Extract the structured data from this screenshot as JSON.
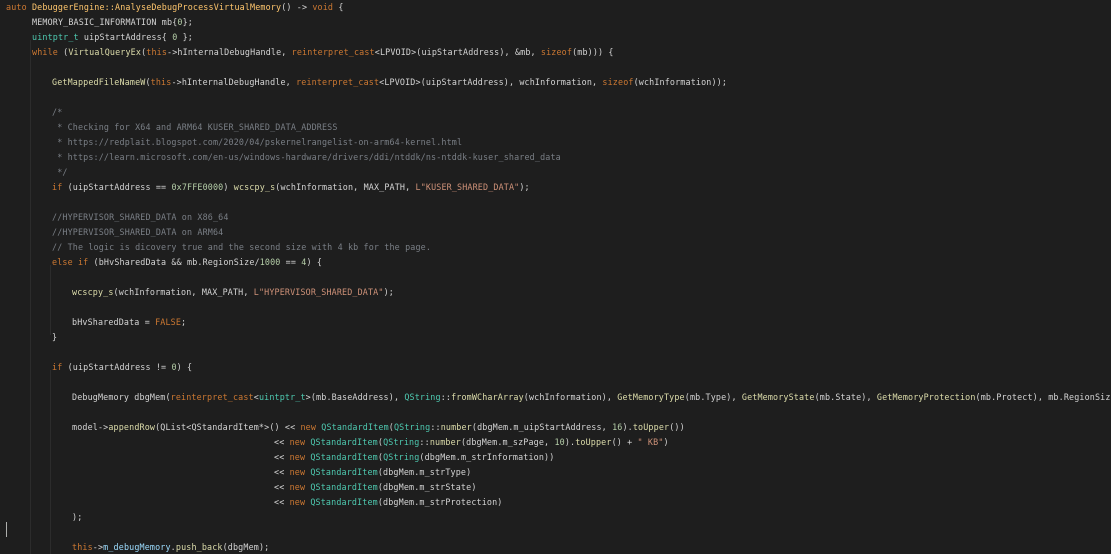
{
  "editor": {
    "language": "C++",
    "theme": {
      "background": "#1e1e1e",
      "keyword": "#cc7832",
      "type": "#4ec9b0",
      "function": "#dcdcaa",
      "number": "#b5cea8",
      "string": "#ce9178",
      "comment": "#7a7f86",
      "default": "#d4d4d4"
    },
    "lines": [
      {
        "indent": 0,
        "tokens": [
          [
            "k",
            "auto "
          ],
          [
            "fc",
            "DebuggerEngine::AnalyseDebugProcessVirtualMemory"
          ],
          [
            "p",
            "() -> "
          ],
          [
            "k",
            "void"
          ],
          [
            "p",
            " {"
          ]
        ]
      },
      {
        "indent": 26,
        "tokens": [
          [
            "p",
            "MEMORY_BASIC_INFORMATION mb{"
          ],
          [
            "n",
            "0"
          ],
          [
            "p",
            "};"
          ]
        ]
      },
      {
        "indent": 26,
        "tokens": [
          [
            "t",
            "uintptr_t"
          ],
          [
            "p",
            " uipStartAddress{ "
          ],
          [
            "n",
            "0"
          ],
          [
            "p",
            " };"
          ]
        ]
      },
      {
        "indent": 26,
        "tokens": [
          [
            "k",
            "while"
          ],
          [
            "p",
            " ("
          ],
          [
            "f",
            "VirtualQueryEx"
          ],
          [
            "p",
            "("
          ],
          [
            "k",
            "this"
          ],
          [
            "p",
            "->hInternalDebugHandle, "
          ],
          [
            "k",
            "reinterpret_cast"
          ],
          [
            "p",
            "<LPVOID>(uipStartAddress), &mb, "
          ],
          [
            "k",
            "sizeof"
          ],
          [
            "p",
            "(mb))) {"
          ]
        ]
      },
      {
        "indent": 46,
        "tokens": [
          [
            "f",
            "GetMappedFileNameW"
          ],
          [
            "p",
            "("
          ],
          [
            "k",
            "this"
          ],
          [
            "p",
            "->hInternalDebugHandle, "
          ],
          [
            "k",
            "reinterpret_cast"
          ],
          [
            "p",
            "<LPVOID>(uipStartAddress), wchInformation, "
          ],
          [
            "k",
            "sizeof"
          ],
          [
            "p",
            "(wchInformation));"
          ]
        ]
      },
      {
        "indent": 46,
        "tokens": [
          [
            "c",
            "/*"
          ]
        ]
      },
      {
        "indent": 46,
        "tokens": [
          [
            "c",
            " * Checking for X64 and ARM64 KUSER_SHARED_DATA_ADDRESS"
          ]
        ]
      },
      {
        "indent": 46,
        "tokens": [
          [
            "c",
            " * https://redplait.blogspot.com/2020/04/pskernelrangelist-on-arm64-kernel.html"
          ]
        ]
      },
      {
        "indent": 46,
        "tokens": [
          [
            "c",
            " * https://learn.microsoft.com/en-us/windows-hardware/drivers/ddi/ntddk/ns-ntddk-kuser_shared_data"
          ]
        ]
      },
      {
        "indent": 46,
        "tokens": [
          [
            "c",
            " */"
          ]
        ]
      },
      {
        "indent": 46,
        "tokens": [
          [
            "k",
            "if"
          ],
          [
            "p",
            " (uipStartAddress == "
          ],
          [
            "n",
            "0x7FFE0000"
          ],
          [
            "p",
            ") "
          ],
          [
            "f",
            "wcscpy_s"
          ],
          [
            "p",
            "(wchInformation, MAX_PATH, "
          ],
          [
            "s",
            "L\"KUSER_SHARED_DATA\""
          ],
          [
            "p",
            ");"
          ]
        ]
      },
      {
        "indent": 46,
        "tokens": [
          [
            "c",
            "//HYPERVISOR_SHARED_DATA on X86_64"
          ]
        ]
      },
      {
        "indent": 46,
        "tokens": [
          [
            "c",
            "//HYPERVISOR_SHARED_DATA on ARM64"
          ]
        ]
      },
      {
        "indent": 46,
        "tokens": [
          [
            "c",
            "// The logic is dicovery true and the second size with 4 kb for the page."
          ]
        ]
      },
      {
        "indent": 46,
        "tokens": [
          [
            "k",
            "else if"
          ],
          [
            "p",
            " (bHvSharedData && mb.RegionSize/"
          ],
          [
            "n",
            "1000"
          ],
          [
            "p",
            " == "
          ],
          [
            "n",
            "4"
          ],
          [
            "p",
            ") {"
          ]
        ]
      },
      {
        "indent": 66,
        "tokens": [
          [
            "f",
            "wcscpy_s"
          ],
          [
            "p",
            "(wchInformation, MAX_PATH, "
          ],
          [
            "s",
            "L\"HYPERVISOR_SHARED_DATA\""
          ],
          [
            "p",
            ");"
          ]
        ]
      },
      {
        "indent": 66,
        "tokens": [
          [
            "p",
            "bHvSharedData = "
          ],
          [
            "k",
            "FALSE"
          ],
          [
            "p",
            ";"
          ]
        ]
      },
      {
        "indent": 46,
        "tokens": [
          [
            "p",
            "}"
          ]
        ]
      },
      {
        "indent": 46,
        "tokens": [
          [
            "k",
            "if"
          ],
          [
            "p",
            " (uipStartAddress != "
          ],
          [
            "n",
            "0"
          ],
          [
            "p",
            ") {"
          ]
        ]
      },
      {
        "indent": 66,
        "tokens": [
          [
            "p",
            "DebugMemory dbgMem("
          ],
          [
            "k",
            "reinterpret_cast"
          ],
          [
            "p",
            "<"
          ],
          [
            "t",
            "uintptr_t"
          ],
          [
            "p",
            ">(mb.BaseAddress), "
          ],
          [
            "t",
            "QString"
          ],
          [
            "p",
            "::"
          ],
          [
            "f",
            "fromWCharArray"
          ],
          [
            "p",
            "(wchInformation), "
          ],
          [
            "f",
            "GetMemoryType"
          ],
          [
            "p",
            "(mb.Type), "
          ],
          [
            "f",
            "GetMemoryState"
          ],
          [
            "p",
            "(mb.State), "
          ],
          [
            "f",
            "GetMemoryProtection"
          ],
          [
            "p",
            "(mb.Protect), mb.RegionSize/"
          ],
          [
            "n",
            "1000"
          ],
          [
            "p",
            ");"
          ]
        ]
      },
      {
        "indent": 66,
        "tokens": [
          [
            "p",
            "model->"
          ],
          [
            "f",
            "appendRow"
          ],
          [
            "p",
            "(QList<QStandardItem*>() << "
          ],
          [
            "k",
            "new"
          ],
          [
            "p",
            " "
          ],
          [
            "t",
            "QStandardItem"
          ],
          [
            "p",
            "("
          ],
          [
            "t",
            "QString"
          ],
          [
            "p",
            "::"
          ],
          [
            "f",
            "number"
          ],
          [
            "p",
            "(dbgMem.m_uipStartAddress, "
          ],
          [
            "n",
            "16"
          ],
          [
            "p",
            ")."
          ],
          [
            "f",
            "toUpper"
          ],
          [
            "p",
            "())"
          ]
        ]
      },
      {
        "indent": 268,
        "tokens": [
          [
            "p",
            "<< "
          ],
          [
            "k",
            "new"
          ],
          [
            "p",
            " "
          ],
          [
            "t",
            "QStandardItem"
          ],
          [
            "p",
            "("
          ],
          [
            "t",
            "QString"
          ],
          [
            "p",
            "::"
          ],
          [
            "f",
            "number"
          ],
          [
            "p",
            "(dbgMem.m_szPage, "
          ],
          [
            "n",
            "10"
          ],
          [
            "p",
            ")."
          ],
          [
            "f",
            "toUpper"
          ],
          [
            "p",
            "() + "
          ],
          [
            "s",
            "\" KB\""
          ],
          [
            "p",
            ")"
          ]
        ]
      },
      {
        "indent": 268,
        "tokens": [
          [
            "p",
            "<< "
          ],
          [
            "k",
            "new"
          ],
          [
            "p",
            " "
          ],
          [
            "t",
            "QStandardItem"
          ],
          [
            "p",
            "("
          ],
          [
            "t",
            "QString"
          ],
          [
            "p",
            "(dbgMem.m_strInformation))"
          ]
        ]
      },
      {
        "indent": 268,
        "tokens": [
          [
            "p",
            "<< "
          ],
          [
            "k",
            "new"
          ],
          [
            "p",
            " "
          ],
          [
            "t",
            "QStandardItem"
          ],
          [
            "p",
            "(dbgMem.m_strType)"
          ]
        ]
      },
      {
        "indent": 268,
        "tokens": [
          [
            "p",
            "<< "
          ],
          [
            "k",
            "new"
          ],
          [
            "p",
            " "
          ],
          [
            "t",
            "QStandardItem"
          ],
          [
            "p",
            "(dbgMem.m_strState)"
          ]
        ]
      },
      {
        "indent": 268,
        "tokens": [
          [
            "p",
            "<< "
          ],
          [
            "k",
            "new"
          ],
          [
            "p",
            " "
          ],
          [
            "t",
            "QStandardItem"
          ],
          [
            "p",
            "(dbgMem.m_strProtection)"
          ]
        ]
      },
      {
        "indent": 66,
        "tokens": [
          [
            "p",
            ");"
          ]
        ]
      },
      {
        "indent": 66,
        "tokens": [
          [
            "k",
            "this"
          ],
          [
            "p",
            "->"
          ],
          [
            "m",
            "m_debugMemory"
          ],
          [
            "p",
            "."
          ],
          [
            "f",
            "push_back"
          ],
          [
            "p",
            "(dbgMem);"
          ]
        ]
      }
    ]
  }
}
